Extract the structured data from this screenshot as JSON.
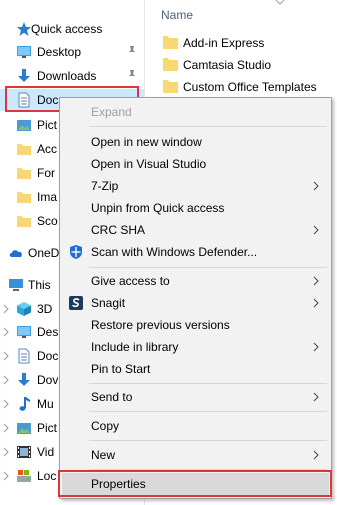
{
  "nav": {
    "quick_access": "Quick access",
    "desktop": "Desktop",
    "downloads": "Downloads",
    "documents": "Doc",
    "pictures": "Pict",
    "folder_acc": "Acc",
    "folder_for": "For",
    "folder_ima": "Ima",
    "folder_sco": "Sco",
    "onedrive": "OneD",
    "this_pc": "This",
    "objects_3d": "3D",
    "pc_desktop": "Des",
    "pc_documents": "Doc",
    "pc_downloads": "Dov",
    "pc_music": "Mu",
    "pc_pictures": "Pict",
    "pc_videos": "Vid",
    "local_disk": "Loc"
  },
  "files": {
    "header": "Name",
    "items": [
      "Add-in Express",
      "Camtasia Studio",
      "Custom Office Templates"
    ]
  },
  "menu": {
    "expand": "Expand",
    "open_new_window": "Open in new window",
    "open_vs": "Open in Visual Studio",
    "seven_zip": "7-Zip",
    "unpin": "Unpin from Quick access",
    "crc_sha": "CRC SHA",
    "scan_defender": "Scan with Windows Defender...",
    "give_access": "Give access to",
    "snagit": "Snagit",
    "restore": "Restore previous versions",
    "include_library": "Include in library",
    "pin_start": "Pin to Start",
    "send_to": "Send to",
    "copy": "Copy",
    "new": "New",
    "properties": "Properties"
  },
  "colors": {
    "highlight_red": "#d9373b",
    "selection": "#cce8ff",
    "menu_bg": "#f2f2f2",
    "folder_yellow": "#f8d775"
  }
}
